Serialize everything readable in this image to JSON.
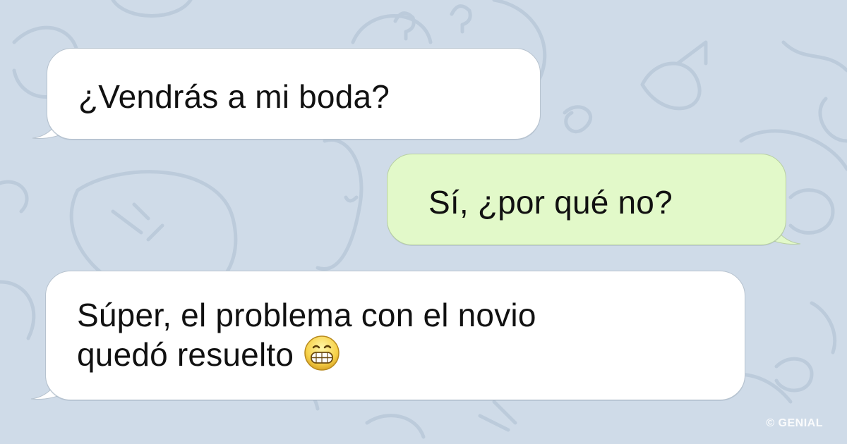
{
  "chat": {
    "messages": [
      {
        "direction": "incoming",
        "lines": [
          "¿Vendrás a mi boda?"
        ]
      },
      {
        "direction": "outgoing",
        "lines": [
          "Sí, ¿por qué no?"
        ]
      },
      {
        "direction": "incoming",
        "lines": [
          "Súper, el problema con el novio",
          "quedó resuelto"
        ],
        "trailing_icon": "grinning-face-icon"
      }
    ]
  },
  "watermark": {
    "text": "© GENIAL"
  },
  "colors": {
    "background": "#cfdbe8",
    "incoming_bubble": "#ffffff",
    "outgoing_bubble": "#e2f9c9",
    "text": "#111111"
  }
}
